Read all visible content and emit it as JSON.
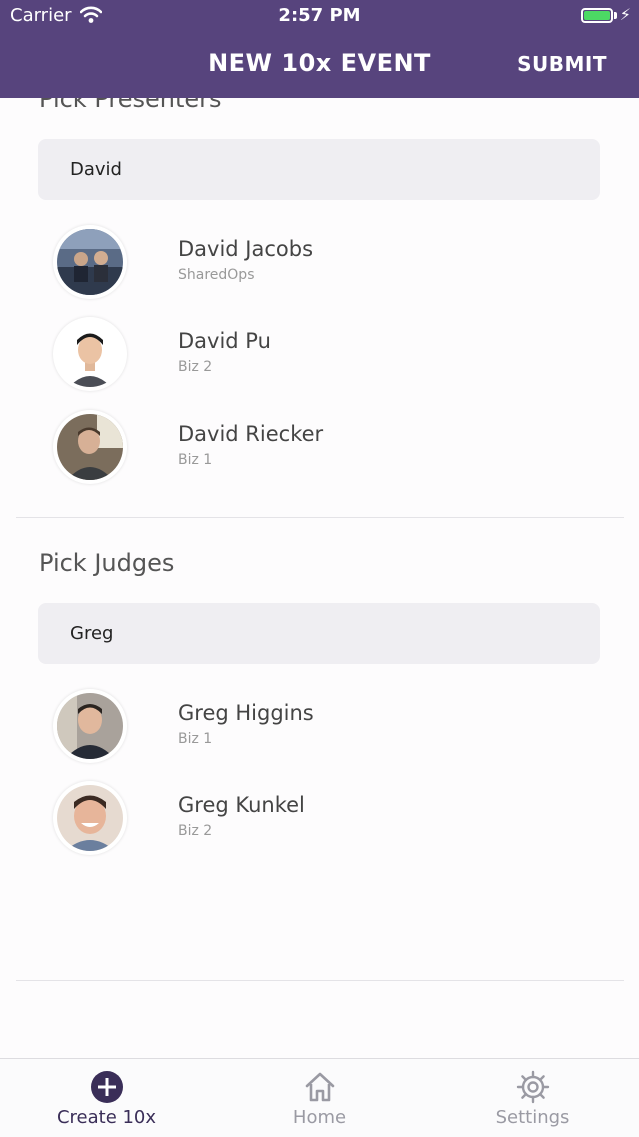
{
  "status_bar": {
    "carrier": "Carrier",
    "time": "2:57 PM"
  },
  "nav": {
    "title": "NEW 10x EVENT",
    "submit_label": "SUBMIT"
  },
  "presenters": {
    "title": "Pick Presenters",
    "search_value": "David",
    "results": [
      {
        "name": "David Jacobs",
        "team": "SharedOps"
      },
      {
        "name": "David Pu",
        "team": "Biz 2"
      },
      {
        "name": "David Riecker",
        "team": "Biz 1"
      }
    ]
  },
  "judges": {
    "title": "Pick Judges",
    "search_value": "Greg",
    "results": [
      {
        "name": "Greg Higgins",
        "team": "Biz 1"
      },
      {
        "name": "Greg Kunkel",
        "team": "Biz 2"
      }
    ]
  },
  "tab_bar": {
    "tabs": [
      {
        "label": "Create 10x",
        "icon": "plus-circle-icon",
        "active": true
      },
      {
        "label": "Home",
        "icon": "home-icon",
        "active": false
      },
      {
        "label": "Settings",
        "icon": "gear-icon",
        "active": false
      }
    ]
  },
  "colors": {
    "header": "#57447d",
    "active_tab": "#3a2e58",
    "inactive_tab": "#9a9aa3",
    "search_bg": "#efeef2"
  }
}
